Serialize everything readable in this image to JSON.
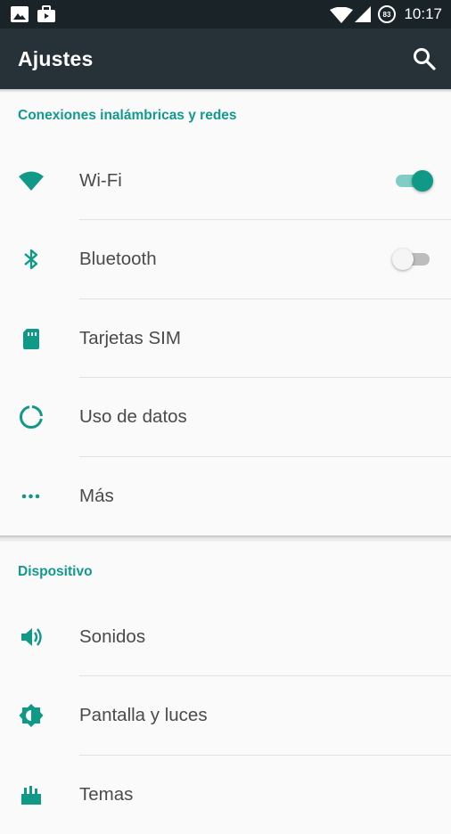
{
  "status_bar": {
    "time": "10:17",
    "battery_level": "83",
    "icons": [
      "image-icon",
      "briefcase-icon",
      "wifi-icon",
      "signal-icon",
      "battery-icon"
    ]
  },
  "app_bar": {
    "title": "Ajustes",
    "search_icon": "search-icon",
    "background": "#263238"
  },
  "accent_color": "#119988",
  "sections": [
    {
      "header": "Conexiones inalámbricas y redes",
      "items": [
        {
          "label": "Wi-Fi",
          "icon": "wifi-icon",
          "toggle": "on"
        },
        {
          "label": "Bluetooth",
          "icon": "bluetooth-icon",
          "toggle": "off"
        },
        {
          "label": "Tarjetas SIM",
          "icon": "sim-card-icon"
        },
        {
          "label": "Uso de datos",
          "icon": "data-usage-icon"
        },
        {
          "label": "Más",
          "icon": "more-icon"
        }
      ]
    },
    {
      "header": "Dispositivo",
      "items": [
        {
          "label": "Sonidos",
          "icon": "volume-icon"
        },
        {
          "label": "Pantalla y luces",
          "icon": "brightness-icon"
        },
        {
          "label": "Temas",
          "icon": "themes-icon"
        }
      ]
    }
  ]
}
